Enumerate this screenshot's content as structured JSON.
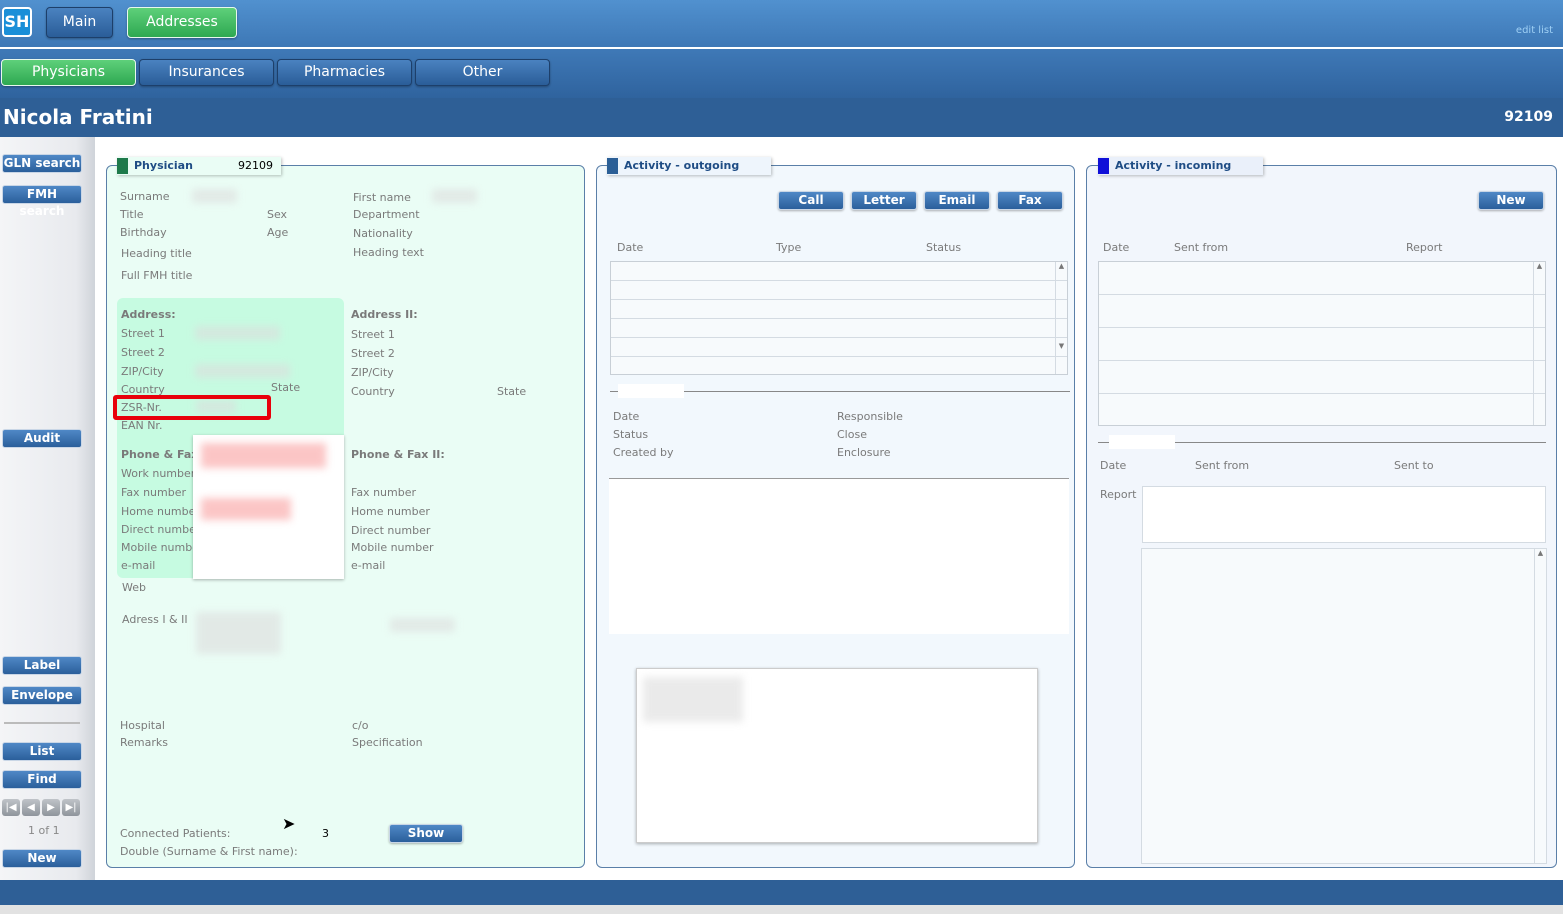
{
  "app": {
    "logo": "SH",
    "edit_list": "edit list"
  },
  "top_tabs": [
    "Main",
    "Addresses"
  ],
  "sub_tabs": [
    "Physicians",
    "Insurances",
    "Pharmacies",
    "Other"
  ],
  "record": {
    "name": "Nicola Fratini",
    "id": "92109"
  },
  "sidebar": {
    "gln": "GLN search",
    "fmh": "FMH search",
    "audit": "Audit",
    "label": "Label",
    "envelope": "Envelope",
    "list": "List",
    "find": "Find",
    "nav": [
      "first",
      "prev",
      "next",
      "last"
    ],
    "counter": "1 of 1",
    "new": "New"
  },
  "physician": {
    "title": "Physician",
    "id": "92109",
    "labels": {
      "surname": "Surname",
      "first_name": "First name",
      "title": "Title",
      "sex": "Sex",
      "department": "Department",
      "birthday": "Birthday",
      "age": "Age",
      "nationality": "Nationality",
      "heading_title": "Heading title",
      "heading_text": "Heading text",
      "fmh_title": "Full FMH title"
    },
    "address": {
      "header": "Address:",
      "street1": "Street 1",
      "street2": "Street 2",
      "zip": "ZIP/City",
      "country": "Country",
      "state": "State",
      "zsr": "ZSR-Nr.",
      "ean": "EAN Nr."
    },
    "address2": {
      "header": "Address II:",
      "street1": "Street 1",
      "street2": "Street 2",
      "zip": "ZIP/City",
      "country": "Country",
      "state": "State"
    },
    "phone": {
      "header": "Phone & Fax:",
      "work": "Work number",
      "fax": "Fax number",
      "home": "Home number",
      "direct": "Direct number",
      "mobile": "Mobile numbe",
      "email": "e-mail",
      "web": "Web"
    },
    "phone2": {
      "header": "Phone & Fax II:",
      "fax": "Fax number",
      "home": "Home number",
      "direct": "Direct number",
      "mobile": "Mobile number",
      "email": "e-mail"
    },
    "adress_both": "Adress I & II",
    "hospital": "Hospital",
    "co": "c/o",
    "remarks": "Remarks",
    "specification": "Specification",
    "connected_label": "Connected Patients:",
    "connected_count": "3",
    "show": "Show",
    "double_label": "Double (Surname & First name):"
  },
  "outgoing": {
    "title": "Activity - outgoing",
    "buttons": [
      "Call",
      "Letter",
      "Email",
      "Fax"
    ],
    "columns": [
      "Date",
      "Type",
      "Status"
    ],
    "detail": {
      "date": "Date",
      "status": "Status",
      "created_by": "Created by",
      "responsible": "Responsible",
      "close": "Close",
      "enclosure": "Enclosure"
    }
  },
  "incoming": {
    "title": "Activity - incoming",
    "new": "New",
    "columns": [
      "Date",
      "Sent from",
      "Report"
    ],
    "detail": {
      "date": "Date",
      "sent_from": "Sent from",
      "sent_to": "Sent to",
      "report": "Report"
    }
  },
  "colors": {
    "accent_green": "#3bb85e",
    "header_blue": "#2e5f96",
    "physician_bg": "#eafdf5",
    "highlight": "#e8000b"
  }
}
